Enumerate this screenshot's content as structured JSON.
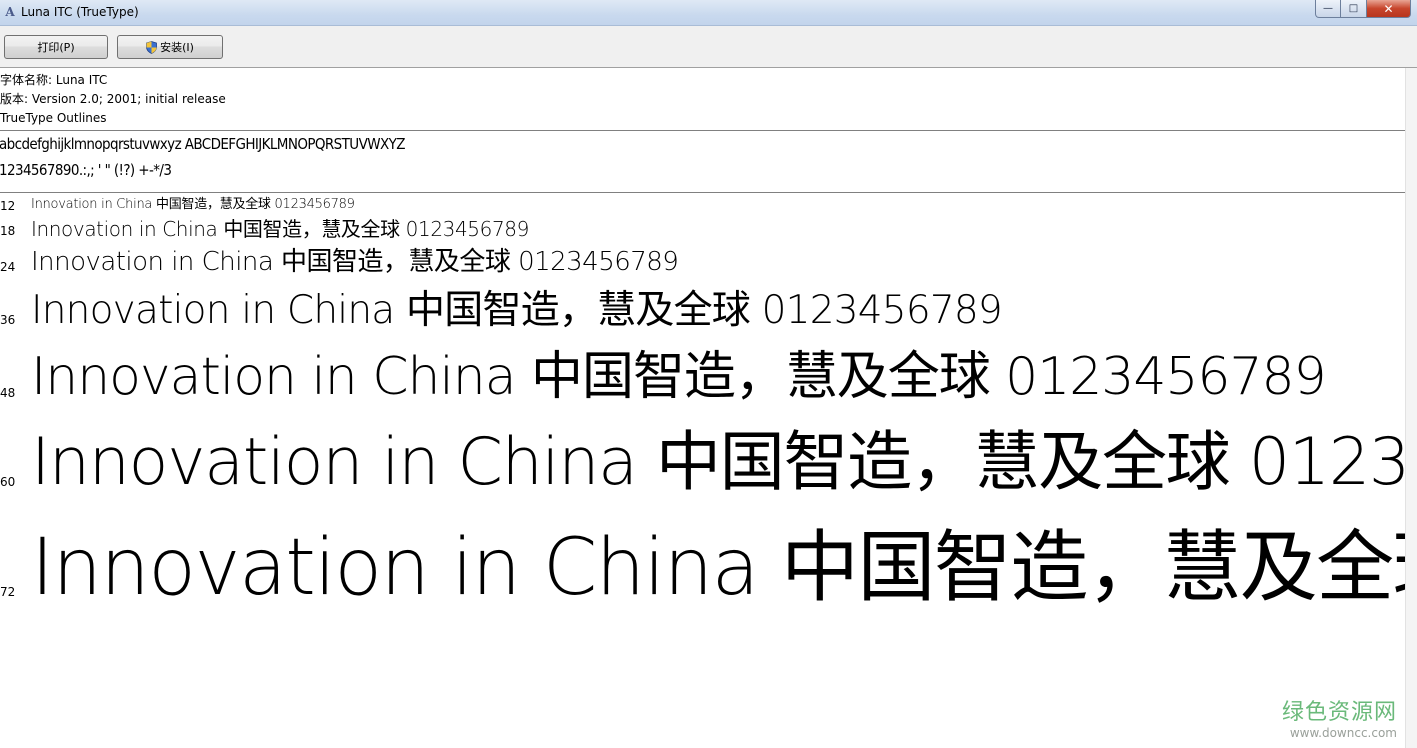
{
  "window": {
    "title": "Luna ITC (TrueType)",
    "caption_min": "—",
    "caption_max": "□",
    "caption_close": "✕"
  },
  "toolbar": {
    "print_label": "打印(P)",
    "install_label": "安装(I)"
  },
  "info": {
    "font_name": "字体名称: Luna ITC",
    "version": "版本: Version 2.0; 2001; initial release",
    "outline": "TrueType Outlines"
  },
  "charset": {
    "line1": "abcdefghijklmnopqrstuvwxyz ABCDEFGHIJKLMNOPQRSTUVWXYZ",
    "line2": "1234567890.:,; ' \" (!?) +-*/3"
  },
  "samples": {
    "text": "Innovation in China 中国智造，慧及全球 0123456789",
    "sizes": [
      "12",
      "18",
      "24",
      "36",
      "48",
      "60",
      "72"
    ]
  },
  "watermark": {
    "name": "绿色资源网",
    "url": "www.downcc.com"
  },
  "colors": {
    "watermark_green": "#6ab97a"
  }
}
